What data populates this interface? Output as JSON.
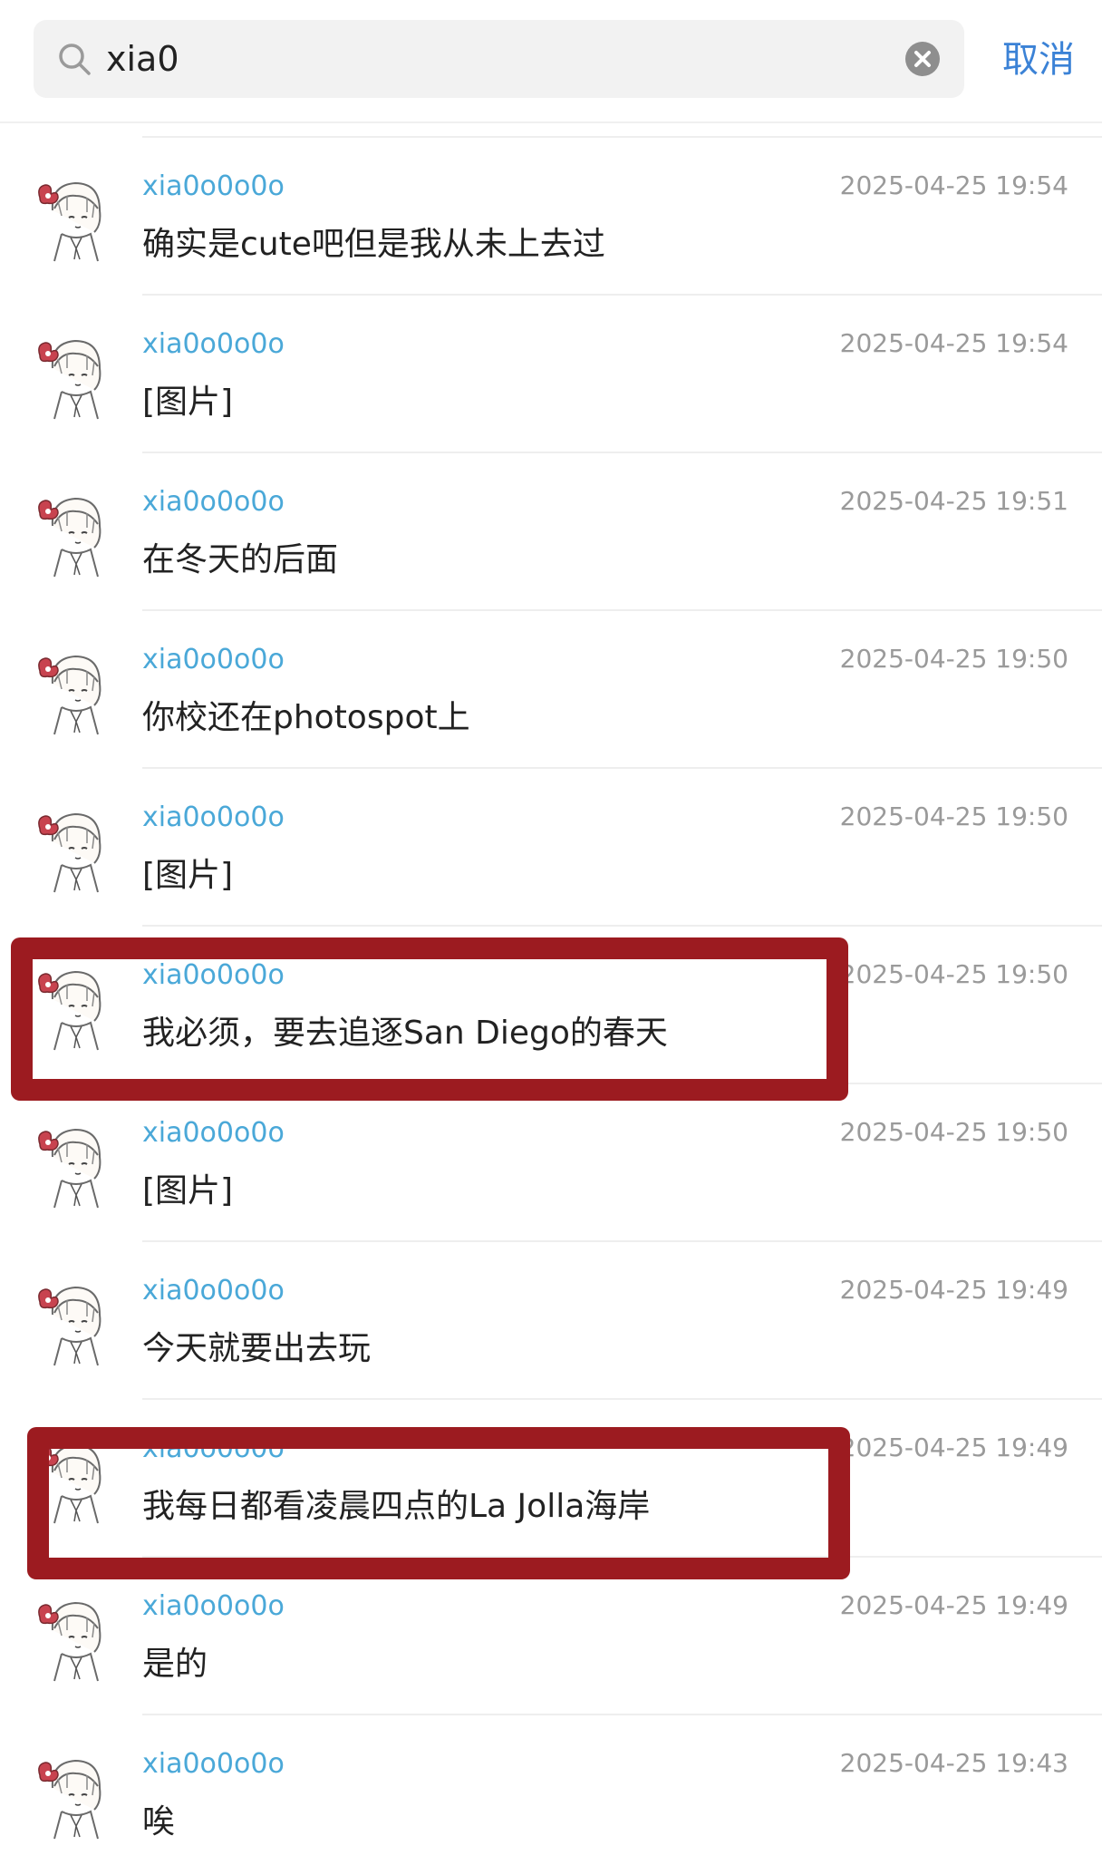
{
  "search": {
    "query": "xia0",
    "cancel_label": "取消"
  },
  "accent_colors": {
    "link": "#3b82d6",
    "sender": "#4aa8d8",
    "highlight_box": "#9c1b20"
  },
  "results": [
    {
      "sender": "xia0o0o0o",
      "time": "2025-04-25 19:54",
      "text": "确实是cute吧但是我从未上去过",
      "highlighted": false
    },
    {
      "sender": "xia0o0o0o",
      "time": "2025-04-25 19:54",
      "text": "[图片]",
      "highlighted": false
    },
    {
      "sender": "xia0o0o0o",
      "time": "2025-04-25 19:51",
      "text": "在冬天的后面",
      "highlighted": false
    },
    {
      "sender": "xia0o0o0o",
      "time": "2025-04-25 19:50",
      "text": "你校还在photospot上",
      "highlighted": false
    },
    {
      "sender": "xia0o0o0o",
      "time": "2025-04-25 19:50",
      "text": "[图片]",
      "highlighted": false
    },
    {
      "sender": "xia0o0o0o",
      "time": "2025-04-25 19:50",
      "text": "我必须，要去追逐San Diego的春天",
      "highlighted": true
    },
    {
      "sender": "xia0o0o0o",
      "time": "2025-04-25 19:50",
      "text": "[图片]",
      "highlighted": false
    },
    {
      "sender": "xia0o0o0o",
      "time": "2025-04-25 19:49",
      "text": "今天就要出去玩",
      "highlighted": false
    },
    {
      "sender": "xia0o0o0o",
      "time": "2025-04-25 19:49",
      "text": "我每日都看凌晨四点的La Jolla海岸",
      "highlighted": true
    },
    {
      "sender": "xia0o0o0o",
      "time": "2025-04-25 19:49",
      "text": "是的",
      "highlighted": false
    },
    {
      "sender": "xia0o0o0o",
      "time": "2025-04-25 19:43",
      "text": "唉",
      "highlighted": false
    }
  ]
}
